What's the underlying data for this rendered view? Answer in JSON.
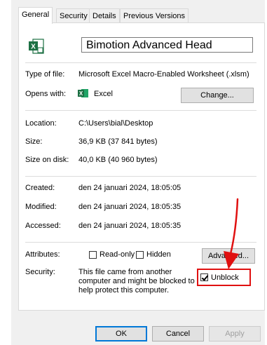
{
  "tabs": [
    "General",
    "Security",
    "Details",
    "Previous Versions"
  ],
  "file_name": "Bimotion Advanced Head",
  "type_label": "Type of file:",
  "type_value": "Microsoft Excel Macro-Enabled Worksheet (.xlsm)",
  "opens_label": "Opens with:",
  "opens_value": "Excel",
  "change_button": "Change...",
  "location_label": "Location:",
  "location_value": "C:\\Users\\bial\\Desktop",
  "size_label": "Size:",
  "size_value": "36,9 KB (37 841 bytes)",
  "size_disk_label": "Size on disk:",
  "size_disk_value": "40,0 KB (40 960 bytes)",
  "created_label": "Created:",
  "created_value": "den 24 januari 2024, 18:05:05",
  "modified_label": "Modified:",
  "modified_value": "den 24 januari 2024, 18:05:35",
  "accessed_label": "Accessed:",
  "accessed_value": "den 24 januari 2024, 18:05:35",
  "attributes_label": "Attributes:",
  "readonly_label": "Read-only",
  "hidden_label": "Hidden",
  "advanced_button": "Advanced...",
  "security_label": "Security:",
  "security_text_1": "This file came from another",
  "security_text_2": "computer and might be blocked to",
  "security_text_3": "help protect this computer.",
  "unblock_label": "Unblock",
  "ok_button": "OK",
  "cancel_button": "Cancel",
  "apply_button": "Apply",
  "colors": {
    "annotation": "#e01010",
    "excel_green": "#1d7044",
    "focus_blue": "#0078d7"
  }
}
